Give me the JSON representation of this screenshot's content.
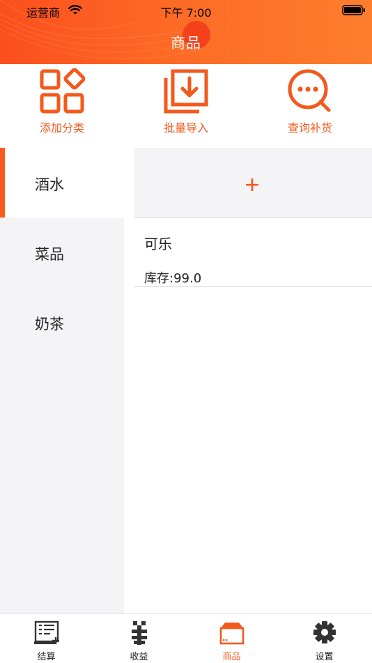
{
  "status_bar": {
    "carrier": "运营商",
    "time": "下午 7:00"
  },
  "nav": {
    "title": "商品"
  },
  "actions": [
    {
      "label": "添加分类",
      "icon": "add-category-icon"
    },
    {
      "label": "批量导入",
      "icon": "batch-import-icon"
    },
    {
      "label": "查询补货",
      "icon": "search-restock-icon"
    }
  ],
  "categories": [
    {
      "label": "酒水",
      "selected": true
    },
    {
      "label": "菜品",
      "selected": false
    },
    {
      "label": "奶茶",
      "selected": false
    }
  ],
  "add_button": {
    "label": "+"
  },
  "products": [
    {
      "name": "可乐",
      "stock": "库存:99.0"
    }
  ],
  "tabs": [
    {
      "label": "结算",
      "icon": "checkout-icon",
      "active": false
    },
    {
      "label": "收益",
      "icon": "earnings-icon",
      "active": false
    },
    {
      "label": "商品",
      "icon": "goods-box-icon",
      "active": true
    },
    {
      "label": "设置",
      "icon": "settings-gear-icon",
      "active": false
    }
  ],
  "colors": {
    "accent": "#f3591d",
    "header_gradient_start": "#fb4f1e",
    "header_gradient_end": "#fe7d2e",
    "sidebar_bg": "#f4f4f6"
  }
}
